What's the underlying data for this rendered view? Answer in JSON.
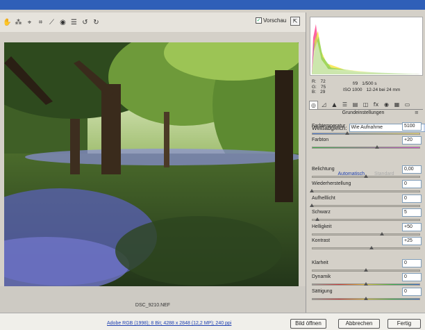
{
  "toolbar": {
    "tools": [
      {
        "icon": "hand-icon",
        "glyph": "✋"
      },
      {
        "icon": "white-balance-icon",
        "glyph": "⁂"
      },
      {
        "icon": "color-sampler-icon",
        "glyph": "⌖"
      },
      {
        "icon": "crop-icon",
        "glyph": "⌗"
      },
      {
        "icon": "straighten-icon",
        "glyph": "⟋"
      },
      {
        "icon": "retouch-icon",
        "glyph": "◉"
      },
      {
        "icon": "preferences-icon",
        "glyph": "☰"
      },
      {
        "icon": "rotate-left-icon",
        "glyph": "↺"
      },
      {
        "icon": "rotate-right-icon",
        "glyph": "↻"
      }
    ],
    "preview_label": "Vorschau",
    "preview_checked": true
  },
  "image": {
    "filename": "DSC_9210.NEF"
  },
  "info": {
    "r_label": "R:",
    "r_value": "72",
    "g_label": "G:",
    "g_value": "75",
    "b_label": "B:",
    "b_value": "29",
    "aperture": "f/9",
    "shutter": "1/500 s",
    "iso": "ISO 1000",
    "lens": "12-24 bei 24 mm"
  },
  "panel": {
    "section_title": "Grundeinstellungen",
    "wb_label": "Weißabgleich:",
    "wb_value": "Wie Aufnahme",
    "auto_label": "Automatisch",
    "default_label": "Standard",
    "sliders": [
      {
        "label": "Farbtemperatur",
        "value": "5100",
        "pos": 0.33
      },
      {
        "label": "Farbton",
        "value": "+20",
        "pos": 0.6
      },
      {
        "label": "Belichtung",
        "value": "0,00",
        "pos": 0.5
      },
      {
        "label": "Wiederherstellung",
        "value": "0",
        "pos": 0.0
      },
      {
        "label": "Aufhelllicht",
        "value": "0",
        "pos": 0.0
      },
      {
        "label": "Schwarz",
        "value": "5",
        "pos": 0.05
      },
      {
        "label": "Helligkeit",
        "value": "+50",
        "pos": 0.65
      },
      {
        "label": "Kontrast",
        "value": "+25",
        "pos": 0.55
      },
      {
        "label": "Klarheit",
        "value": "0",
        "pos": 0.5
      },
      {
        "label": "Dynamik",
        "value": "0",
        "pos": 0.5
      },
      {
        "label": "Sättigung",
        "value": "0",
        "pos": 0.5
      }
    ]
  },
  "footer": {
    "workflow": "Adobe RGB (1998); 8 Bit; 4288 x 2848 (12,2 MP); 240 ppi",
    "open_button": "Bild öffnen",
    "cancel_button": "Abbrechen",
    "done_button": "Fertig"
  },
  "colors": {
    "titlebar": "#2f5fb8",
    "link": "#1d3fb0"
  }
}
